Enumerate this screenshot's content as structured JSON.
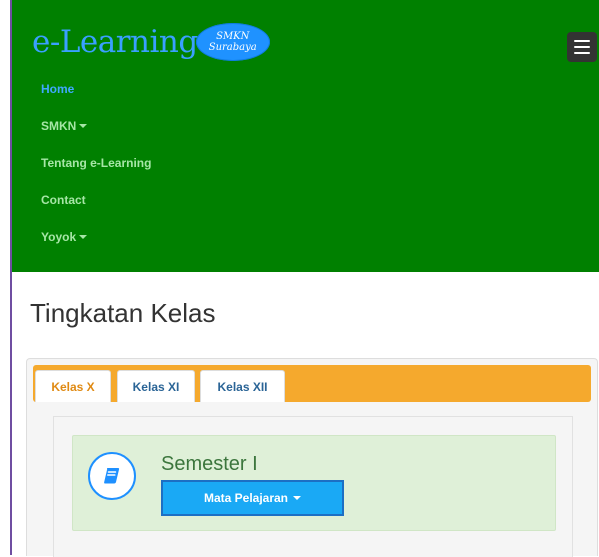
{
  "brand": {
    "title": "e-Learning",
    "badge_line1": "SMKN",
    "badge_line2": "Surabaya"
  },
  "navbar": {
    "toggle_icon": "hamburger-icon",
    "items": [
      {
        "label": "Home",
        "active": true
      },
      {
        "label": "SMKN",
        "dropdown": true
      },
      {
        "label": "Tentang e-Learning"
      },
      {
        "label": "Contact"
      },
      {
        "label": "Yoyok",
        "dropdown": true
      }
    ]
  },
  "page": {
    "title": "Tingkatan Kelas"
  },
  "tabs": [
    {
      "label": "Kelas X",
      "active": true
    },
    {
      "label": "Kelas XI"
    },
    {
      "label": "Kelas XII"
    }
  ],
  "semester": {
    "icon": "book-icon",
    "title": "Semester I",
    "button_label": "Mata Pelajaran"
  },
  "colors": {
    "navbar_bg": "#008000",
    "tab_strip": "#f5a92d",
    "active_nav": "#40a8ff",
    "button": "#1aa9f5"
  }
}
